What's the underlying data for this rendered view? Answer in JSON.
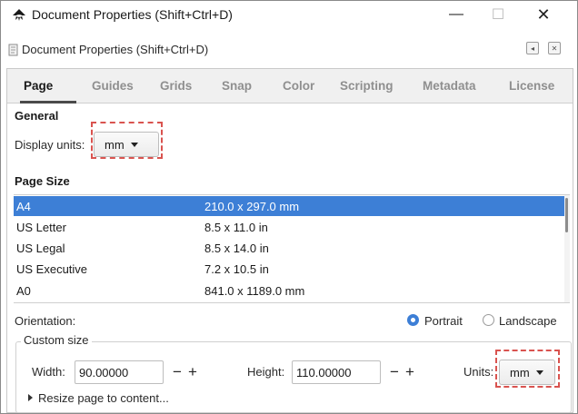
{
  "window": {
    "title": "Document Properties (Shift+Ctrl+D)",
    "minimize_glyph": "—",
    "maximize_glyph": "☐",
    "close_glyph": "✕"
  },
  "dock": {
    "title": "Document Properties (Shift+Ctrl+D)",
    "left_glyph": "◂",
    "close_glyph": "✕"
  },
  "tabs": [
    {
      "label": "Page",
      "active": true
    },
    {
      "label": "Guides",
      "active": false
    },
    {
      "label": "Grids",
      "active": false
    },
    {
      "label": "Snap",
      "active": false
    },
    {
      "label": "Color",
      "active": false
    },
    {
      "label": "Scripting",
      "active": false
    },
    {
      "label": "Metadata",
      "active": false
    },
    {
      "label": "License",
      "active": false
    }
  ],
  "general": {
    "heading": "General",
    "display_units_label": "Display units:",
    "display_units_value": "mm"
  },
  "page_size": {
    "heading": "Page Size",
    "rows": [
      {
        "name": "A4",
        "size": "210.0 x 297.0 mm",
        "selected": true
      },
      {
        "name": "US Letter",
        "size": "8.5 x 11.0 in",
        "selected": false
      },
      {
        "name": "US Legal",
        "size": "8.5 x 14.0 in",
        "selected": false
      },
      {
        "name": "US Executive",
        "size": "7.2 x 10.5 in",
        "selected": false
      },
      {
        "name": "A0",
        "size": "841.0 x 1189.0 mm",
        "selected": false
      }
    ]
  },
  "orientation": {
    "label": "Orientation:",
    "portrait_label": "Portrait",
    "landscape_label": "Landscape",
    "selected": "Portrait"
  },
  "custom_size": {
    "legend": "Custom size",
    "width_label": "Width:",
    "width_value": "90.00000",
    "height_label": "Height:",
    "height_value": "110.00000",
    "units_label": "Units:",
    "units_value": "mm",
    "minus_glyph": "−",
    "plus_glyph": "+",
    "resize_label": "Resize page to content..."
  },
  "colors": {
    "selection": "#3d7fd6",
    "highlight_dash": "#d9534f",
    "inactive_tab": "#8f8f8f"
  }
}
